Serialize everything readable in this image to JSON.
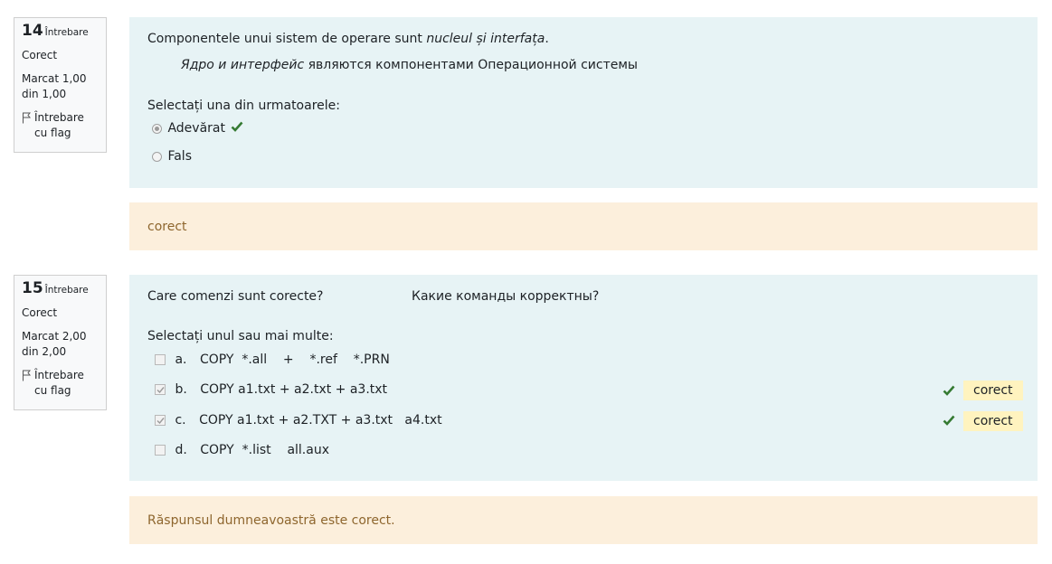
{
  "questions": [
    {
      "number": "14",
      "word": "Întrebare",
      "state": "Corect",
      "grade": "Marcat 1,00 din 1,00",
      "flag_label": "Întrebare cu flag",
      "text_plain": "Componentele unui sistem de operare sunt ",
      "text_italic": "nucleul și interfața",
      "text_end": ".",
      "ru_italic": "Ядро и интерфейс",
      "ru_plain": " являются компонентами Операционной системы",
      "prompt": "Selectați una din urmatoarele:",
      "options": [
        {
          "label": "Adevărat",
          "selected": true,
          "correct": true
        },
        {
          "label": "Fals",
          "selected": false,
          "correct": false
        }
      ],
      "feedback": "corect"
    },
    {
      "number": "15",
      "word": "Întrebare",
      "state": "Corect",
      "grade": "Marcat 2,00 din 2,00",
      "flag_label": "Întrebare cu flag",
      "text_ro": "Care comenzi sunt corecte?",
      "text_ru": "Какие команды корректны?",
      "prompt": "Selectați unul sau mai multe:",
      "options": [
        {
          "letter": "a.",
          "label": "COPY  *.all    +    *.ref    *.PRN",
          "selected": false
        },
        {
          "letter": "b.",
          "label": "COPY a1.txt + a2.txt + a3.txt",
          "selected": true,
          "badge": "corect"
        },
        {
          "letter": "c.",
          "label": "COPY a1.txt + a2.TXT + a3.txt   a4.txt",
          "selected": true,
          "badge": "corect"
        },
        {
          "letter": "d.",
          "label": "COPY  *.list    all.aux",
          "selected": false
        }
      ],
      "feedback": "Răspunsul dumneavoastră este corect."
    }
  ],
  "colors": {
    "formulation_bg": "#e7f3f5",
    "feedback_bg": "#fcefdc",
    "feedback_text": "#8e662e",
    "check_green": "#357a32",
    "badge_bg": "#fff3bf"
  }
}
